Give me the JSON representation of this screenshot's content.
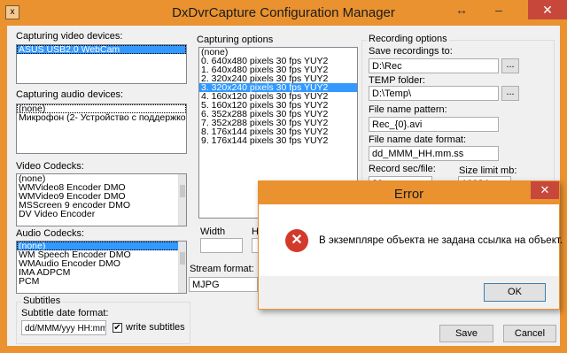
{
  "window": {
    "title": "DxDvrCapture Configuration Manager",
    "resize_glyph": "↔",
    "minimize_glyph": "–",
    "close_glyph": "✕",
    "app_icon": "x"
  },
  "video_devices": {
    "label": "Capturing video devices:",
    "items": [
      "ASUS USB2.0 WebCam"
    ]
  },
  "audio_devices": {
    "label": "Capturing audio devices:",
    "items": [
      "(none)",
      "Микрофон (2- Устройство с поддержкой Н"
    ]
  },
  "video_codecs": {
    "label": "Video Codecks:",
    "items": [
      "(none)",
      "WMVideo8 Encoder DMO",
      "WMVideo9 Encoder DMO",
      "MSScreen 9 encoder DMO",
      "DV Video Encoder"
    ]
  },
  "audio_codecs": {
    "label": "Audio Codecks:",
    "items": [
      "(none)",
      "WM Speech Encoder DMO",
      "WMAudio Encoder DMO",
      "IMA ADPCM",
      "PCM"
    ]
  },
  "subtitles": {
    "group_label": "Subtitles",
    "date_format_label": "Subtitle date format:",
    "date_format_value": "dd/MMM/yyy HH:mm:s",
    "write_label": "write subtitles",
    "write_checked_glyph": "✔"
  },
  "capturing_options": {
    "label": "Capturing options",
    "items": [
      "(none)",
      "0. 640x480 pixels 30 fps YUY2",
      "1. 640x480 pixels 30 fps YUY2",
      "2. 320x240 pixels 30 fps YUY2",
      "3. 320x240 pixels 30 fps YUY2",
      "4. 160x120 pixels 30 fps YUY2",
      "5. 160x120 pixels 30 fps YUY2",
      "6. 352x288 pixels 30 fps YUY2",
      "7. 352x288 pixels 30 fps YUY2",
      "8. 176x144 pixels 30 fps YUY2",
      "9. 176x144 pixels 30 fps YUY2"
    ],
    "selected_index": 4,
    "width_label": "Width",
    "height_label": "He",
    "stream_format_label": "Stream format:",
    "stream_format_value": "MJPG"
  },
  "recording": {
    "group_label": "Recording options",
    "save_label": "Save recordings to:",
    "save_value": "D:\\Rec",
    "temp_label": "TEMP folder:",
    "temp_value": "D:\\Temp\\",
    "pattern_label": "File name pattern:",
    "pattern_value": "Rec_{0}.avi",
    "date_format_label": "File name date format:",
    "date_format_value": "dd_MMM_HH.mm.ss",
    "record_sec_label": "Record sec/file:",
    "record_sec_value": "30",
    "size_limit_label": "Size limit mb:",
    "size_limit_value": "10024",
    "browse_label": "..."
  },
  "buttons": {
    "save": "Save",
    "cancel": "Cancel"
  },
  "error_dialog": {
    "title": "Error",
    "message": "В экземпляре объекта не задана ссылка на объект.",
    "ok": "OK",
    "close_glyph": "✕",
    "icon_glyph": "✕"
  }
}
